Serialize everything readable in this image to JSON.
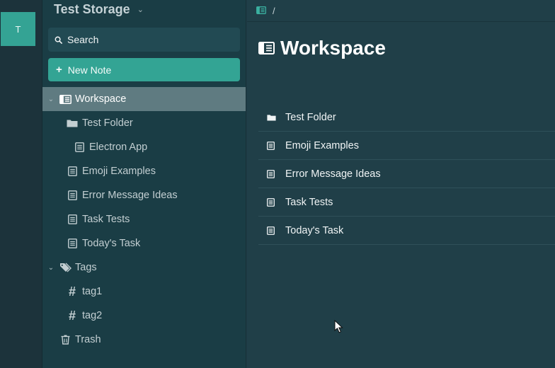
{
  "storage_rail": {
    "active_storage_initial": "T"
  },
  "sidebar": {
    "storage_name": "Test Storage",
    "search_label": "Search",
    "new_note_label": "New Note",
    "tree": {
      "workspace": "Workspace",
      "test_folder": "Test Folder",
      "electron_app": "Electron App",
      "emoji_examples": "Emoji Examples",
      "error_message_ideas": "Error Message Ideas",
      "task_tests": "Task Tests",
      "todays_task": "Today's Task",
      "tags": "Tags",
      "tag1": "tag1",
      "tag2": "tag2",
      "trash": "Trash"
    }
  },
  "main": {
    "breadcrumb": "/",
    "title": "Workspace",
    "items": [
      {
        "label": "Test Folder",
        "icon": "folder-icon"
      },
      {
        "label": "Emoji Examples",
        "icon": "note-icon"
      },
      {
        "label": "Error Message Ideas",
        "icon": "note-icon"
      },
      {
        "label": "Task Tests",
        "icon": "note-icon"
      },
      {
        "label": "Today's Task",
        "icon": "note-icon"
      }
    ]
  },
  "colors": {
    "accent": "#33a494",
    "sidebar_bg": "#1a3d45",
    "main_bg": "#203f48",
    "selected_row": "#5f7b81"
  }
}
